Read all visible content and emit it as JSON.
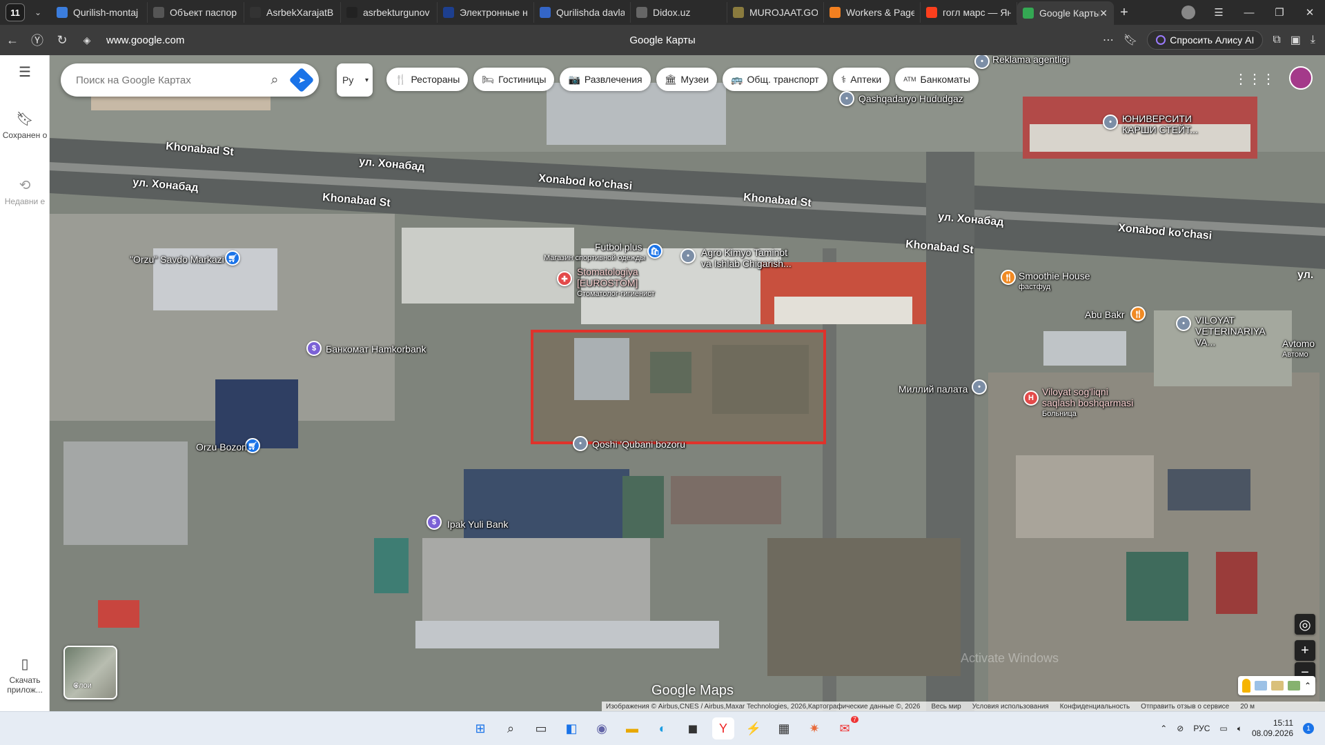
{
  "browser": {
    "tab_count": "11",
    "tabs": [
      {
        "title": "Qurilish-montaj",
        "icon_color": "#3b7ddd"
      },
      {
        "title": "Объект паспор",
        "icon_color": "#555555"
      },
      {
        "title": "AsrbekXarajatB",
        "icon_color": "#333333"
      },
      {
        "title": "asrbekturgunov",
        "icon_color": "#222222"
      },
      {
        "title": "Электронные н",
        "icon_color": "#1d3f8f"
      },
      {
        "title": "Qurilishda davla",
        "icon_color": "#3466c8"
      },
      {
        "title": "Didox.uz",
        "icon_color": "#666666"
      },
      {
        "title": "MUROJAAT.GOV",
        "icon_color": "#8a7b3e"
      },
      {
        "title": "Workers & Page",
        "icon_color": "#f38020"
      },
      {
        "title": "гогл марс — Ян",
        "icon_color": "#fc3f1d"
      },
      {
        "title": "Google Карты",
        "icon_color": "#34a853"
      }
    ],
    "url": "www.google.com",
    "page_title": "Google Карты",
    "alice_label": "Спросить Алису AI"
  },
  "rail": {
    "saved_label": "Сохранен о",
    "recent_label": "Недавни е",
    "download_label": "Скачать прилож..."
  },
  "search": {
    "placeholder": "Поиск на Google Картах",
    "lang": "Ру"
  },
  "chips": [
    {
      "icon": "fork-knife",
      "glyph": "🍴",
      "label": "Рестораны"
    },
    {
      "icon": "bed",
      "glyph": "🛏",
      "label": "Гостиницы"
    },
    {
      "icon": "camera",
      "glyph": "📷",
      "label": "Развлечения"
    },
    {
      "icon": "museum",
      "glyph": "🏛",
      "label": "Музеи"
    },
    {
      "icon": "bus",
      "glyph": "🚌",
      "label": "Общ. транспорт"
    },
    {
      "icon": "pharmacy",
      "glyph": "⚕",
      "label": "Аптеки"
    },
    {
      "icon": "atm",
      "glyph": "ATM",
      "label": "Банкоматы"
    }
  ],
  "map": {
    "streets": [
      "Khonabad St",
      "ул. Хонабад",
      "ул. Хонабад",
      "Khonabad St",
      "Xonabod ko'chasi",
      "Khonabad St",
      "ул. Хонабад",
      "Xonabod ko'chasi",
      "Khonabad St",
      "ул."
    ],
    "places": [
      {
        "name": "Reklama agentligi",
        "sub": "",
        "kind": "grey"
      },
      {
        "name": "Qashqadaryo Hududgaz",
        "sub": "",
        "kind": "grey"
      },
      {
        "name": "ЮНИВЕРСИТИ КАРШИ СТЕЙТ...",
        "sub": "",
        "kind": "grey"
      },
      {
        "name": "\"Orzu\" Savdo Markazi",
        "sub": "",
        "kind": "blue"
      },
      {
        "name": "Futbol plus",
        "sub": "Магазин спортивной одежды",
        "kind": "blue"
      },
      {
        "name": "Agro Kimyo Taminot va Ishlab Chigarish...",
        "sub": "",
        "kind": "grey"
      },
      {
        "name": "Stomatologiya [EUROSTOM]",
        "sub": "Стоматолог-гигиенист",
        "kind": "red"
      },
      {
        "name": "Smoothie House",
        "sub": "фастфуд",
        "kind": "orange"
      },
      {
        "name": "Abu Bakr",
        "sub": "",
        "kind": "orange"
      },
      {
        "name": "VILOYAT VETERINARIYA VA...",
        "sub": "",
        "kind": "grey"
      },
      {
        "name": "Avtomo",
        "sub": "Автомо",
        "kind": "grey"
      },
      {
        "name": "Банкомат Hamkorbank",
        "sub": "",
        "kind": "purple"
      },
      {
        "name": "Миллий палата",
        "sub": "",
        "kind": "grey"
      },
      {
        "name": "Viloyat sog'liqni saqlash boshqarmasi",
        "sub": "Больница",
        "kind": "red"
      },
      {
        "name": "Orzu Bozori",
        "sub": "",
        "kind": "blue"
      },
      {
        "name": "Qoshi 'Qubani bozoru",
        "sub": "",
        "kind": "grey"
      },
      {
        "name": "Ipak Yuli Bank",
        "sub": "",
        "kind": "purple"
      }
    ],
    "layers_label": "Слои",
    "logo": "Google Maps",
    "attribution": [
      "Изображения © Airbus,CNES / Airbus,Maxar Technologies, 2026,Картографические данные ©, 2026",
      "Весь мир",
      "Условия использования",
      "Конфиденциальность",
      "Отправить отзыв о сервисе",
      "20 м"
    ],
    "watermark": "Activate Windows"
  },
  "taskbar": {
    "lang": "РУС",
    "time": "15:11",
    "date": "08.09.2026",
    "notif_count": "1",
    "badge": "7"
  }
}
